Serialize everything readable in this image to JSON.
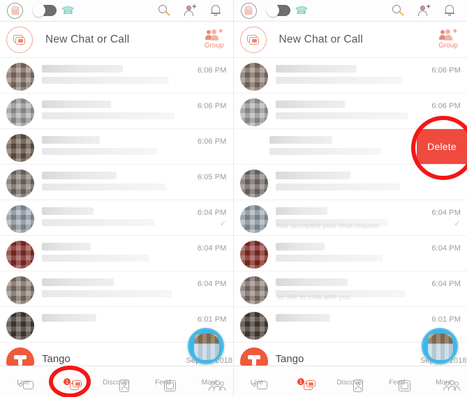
{
  "app": {
    "name": "Tango",
    "accent": "#ea6a4d",
    "delete_color": "#f04a3f",
    "annotation_color": "#f51616"
  },
  "navbar": {
    "avatar_icon": "profile-avatar-icon",
    "toggle_state": "off",
    "phone_icon": "phone-icon",
    "icons": [
      {
        "name": "search-icon",
        "label": "Search"
      },
      {
        "name": "add-person-icon",
        "label": "Add Contact"
      },
      {
        "name": "bell-icon",
        "label": "Notifications"
      }
    ]
  },
  "new_chat": {
    "icon": "new-chat-icon",
    "label": "New Chat or Call",
    "group_icon": "group-add-icon",
    "group_label": "Group"
  },
  "left_panel": {
    "rows": [
      {
        "time": "6:06 PM",
        "checked": false,
        "name_w": "56%",
        "msg_w": "88%",
        "avatar": "#8d7a6e",
        "ghost": ""
      },
      {
        "time": "6:06 PM",
        "checked": false,
        "name_w": "48%",
        "msg_w": "92%",
        "avatar": "#a8a8a8",
        "ghost": ""
      },
      {
        "time": "6:06 PM",
        "checked": false,
        "name_w": "40%",
        "msg_w": "80%",
        "avatar": "#6b5a4c",
        "ghost": ""
      },
      {
        "time": "6:05 PM",
        "checked": false,
        "name_w": "52%",
        "msg_w": "86%",
        "avatar": "#7f7570",
        "ghost": ""
      },
      {
        "time": "6:04 PM",
        "checked": true,
        "name_w": "36%",
        "msg_w": "78%",
        "avatar": "#9aa3ad",
        "ghost": ""
      },
      {
        "time": "6:04 PM",
        "checked": false,
        "name_w": "34%",
        "msg_w": "74%",
        "avatar": "#8e3028",
        "ghost": ""
      },
      {
        "time": "6:04 PM",
        "checked": false,
        "name_w": "50%",
        "msg_w": "90%",
        "avatar": "#8a7a72",
        "ghost": ""
      },
      {
        "time": "6:01 PM",
        "checked": false,
        "name_w": "38%",
        "msg_w": "0%",
        "avatar": "#4d4038",
        "ghost": ""
      }
    ],
    "tango_row": {
      "name": "Tango",
      "time": "Sep 18, 2018"
    },
    "bubble_icon": "floating-chat-head-avatar"
  },
  "right_panel": {
    "rows": [
      {
        "time": "6:06 PM",
        "checked": false,
        "name_w": "56%",
        "msg_w": "88%",
        "avatar": "#8d7a6e",
        "swiped": false,
        "ghost": ""
      },
      {
        "time": "6:06 PM",
        "checked": false,
        "name_w": "48%",
        "msg_w": "92%",
        "avatar": "#a8a8a8",
        "swiped": false,
        "ghost": ""
      },
      {
        "time": "",
        "checked": false,
        "name_w": "42%",
        "msg_w": "74%",
        "avatar": "#6b5a4c",
        "swiped": true,
        "ghost": ""
      },
      {
        "time": "",
        "checked": false,
        "name_w": "52%",
        "msg_w": "86%",
        "avatar": "#7f7570",
        "swiped": false,
        "ghost": ""
      },
      {
        "time": "6:04 PM",
        "checked": true,
        "name_w": "36%",
        "msg_w": "78%",
        "avatar": "#9aa3ad",
        "swiped": false,
        "ghost": "has accepted your chat request"
      },
      {
        "time": "6:04 PM",
        "checked": false,
        "name_w": "34%",
        "msg_w": "74%",
        "avatar": "#8e3028",
        "swiped": false,
        "ghost": ""
      },
      {
        "time": "6:04 PM",
        "checked": false,
        "name_w": "50%",
        "msg_w": "90%",
        "avatar": "#8a7a72",
        "swiped": false,
        "ghost": "so like to chat with you."
      },
      {
        "time": "6:01 PM",
        "checked": false,
        "name_w": "38%",
        "msg_w": "0%",
        "avatar": "#4d4038",
        "swiped": false,
        "ghost": ""
      }
    ],
    "delete_label": "Delete",
    "tango_row": {
      "name": "Tango",
      "time": "Sep 18, 2018"
    },
    "bubble_icon": "floating-chat-head-avatar"
  },
  "tabbar": {
    "tabs": [
      {
        "name": "live",
        "label": "Live",
        "icon": "video-camera-icon",
        "active": false,
        "badge": ""
      },
      {
        "name": "chat",
        "label": "Chat",
        "icon": "chat-bubbles-icon",
        "active": true,
        "badge": "1"
      },
      {
        "name": "discover",
        "label": "Discover",
        "icon": "discover-card-icon",
        "active": false,
        "badge": ""
      },
      {
        "name": "feed",
        "label": "Feed",
        "icon": "feed-grid-icon",
        "active": false,
        "badge": ""
      },
      {
        "name": "more",
        "label": "More",
        "icon": "people-more-icon",
        "active": false,
        "badge": ""
      }
    ]
  },
  "annotations": [
    {
      "name": "chat-tab-highlight-left",
      "target": "chat-tab"
    },
    {
      "name": "delete-button-highlight",
      "target": "delete-button"
    }
  ]
}
